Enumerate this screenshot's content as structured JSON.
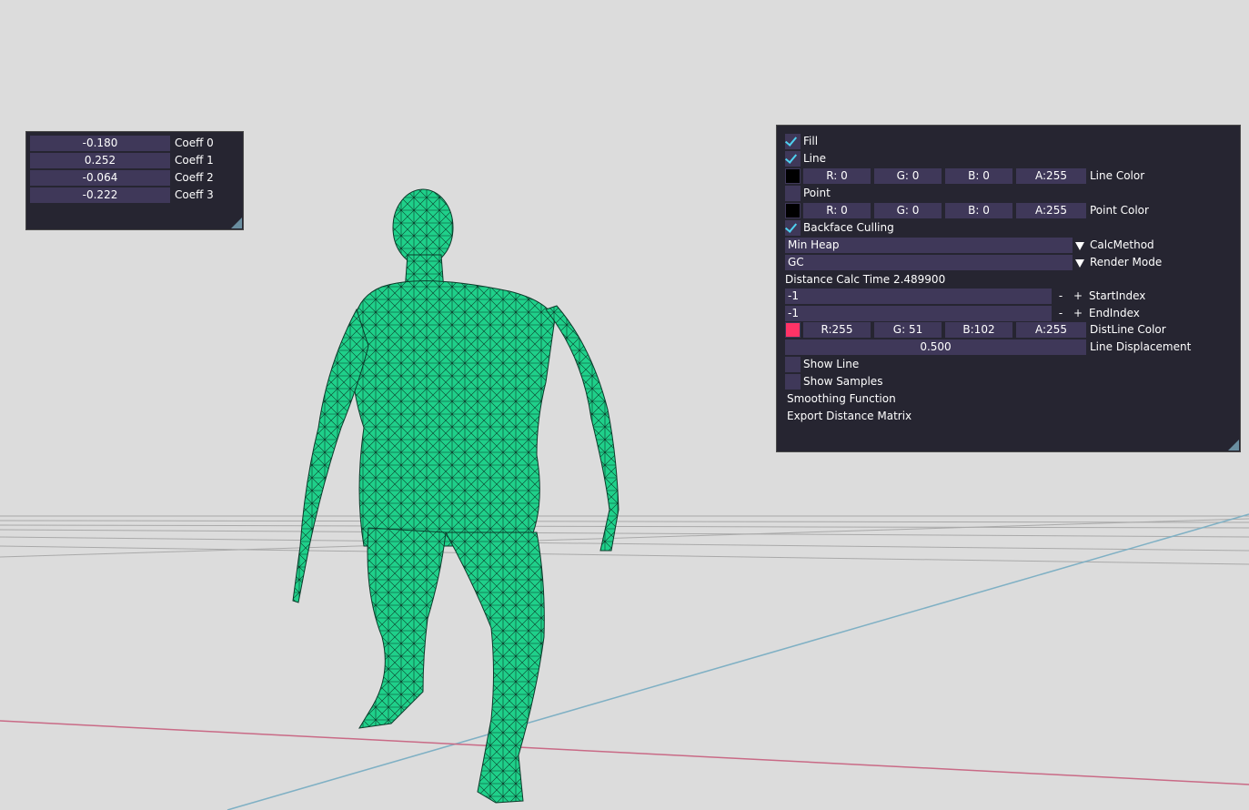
{
  "coeff_panel": {
    "rows": [
      {
        "value": "-0.180",
        "label": "Coeff 0"
      },
      {
        "value": "0.252",
        "label": "Coeff 1"
      },
      {
        "value": "-0.064",
        "label": "Coeff 2"
      },
      {
        "value": "-0.222",
        "label": "Coeff 3"
      }
    ]
  },
  "settings": {
    "fill": {
      "label": "Fill",
      "checked": true
    },
    "line": {
      "label": "Line",
      "checked": true
    },
    "line_color": {
      "r": "R:  0",
      "g": "G:  0",
      "b": "B:  0",
      "a": "A:255",
      "label": "Line Color",
      "swatch": "#000000"
    },
    "point": {
      "label": "Point",
      "checked": false
    },
    "point_color": {
      "r": "R:  0",
      "g": "G:  0",
      "b": "B:  0",
      "a": "A:255",
      "label": "Point Color",
      "swatch": "#000000"
    },
    "backface": {
      "label": "Backface Culling",
      "checked": true
    },
    "calc_method": {
      "value": "Min Heap",
      "label": "CalcMethod"
    },
    "render_mode": {
      "value": "GC",
      "label": "Render Mode"
    },
    "calc_time": "Distance Calc Time 2.489900",
    "start_index": {
      "value": "-1",
      "minus": "-",
      "plus": "+",
      "label": "StartIndex"
    },
    "end_index": {
      "value": "-1",
      "minus": "-",
      "plus": "+",
      "label": "EndIndex"
    },
    "distline_color": {
      "r": "R:255",
      "g": "G: 51",
      "b": "B:102",
      "a": "A:255",
      "label": "DistLine Color",
      "swatch": "#ff3366"
    },
    "line_displacement": {
      "value": "0.500",
      "label": "Line Displacement"
    },
    "show_line": {
      "label": "Show Line",
      "checked": false
    },
    "show_samples": {
      "label": "Show Samples",
      "checked": false
    },
    "smoothing_function": "Smoothing Function",
    "export_matrix": "Export Distance Matrix"
  },
  "colors": {
    "background": "#dcdcdc",
    "panel": "#262531",
    "field": "#3f3859",
    "mesh": "#1fd08a",
    "check": "#4fd1f0"
  }
}
